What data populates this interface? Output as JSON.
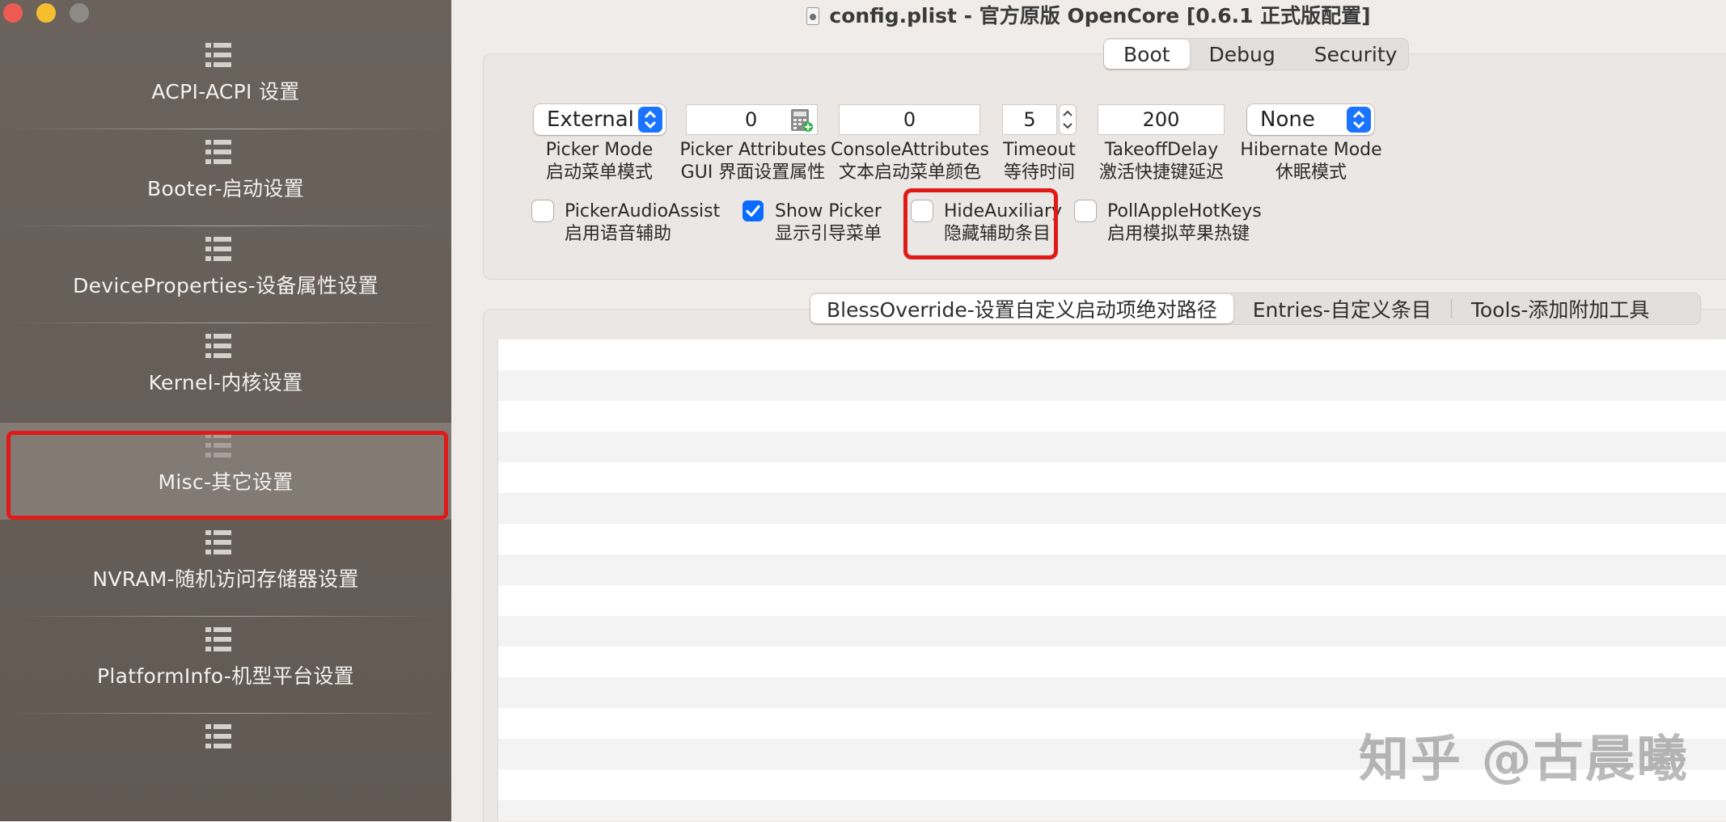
{
  "window": {
    "title": "config.plist - 官方原版 OpenCore [0.6.1 正式版配置]"
  },
  "sidebar": {
    "items": [
      {
        "label": "ACPI-ACPI 设置"
      },
      {
        "label": "Booter-启动设置"
      },
      {
        "label": "DeviceProperties-设备属性设置"
      },
      {
        "label": "Kernel-内核设置"
      },
      {
        "label": "Misc-其它设置",
        "selected": true
      },
      {
        "label": "NVRAM-随机访问存储器设置"
      },
      {
        "label": "PlatformInfo-机型平台设置"
      },
      {
        "label": ""
      }
    ]
  },
  "top_tabs": [
    "Boot",
    "Debug",
    "Security"
  ],
  "boot": {
    "picker_mode": {
      "value": "External",
      "caption1": "Picker Mode",
      "caption2": "启动菜单模式"
    },
    "picker_attributes": {
      "value": "0",
      "caption1": "Picker Attributes",
      "caption2": "GUI 界面设置属性"
    },
    "console_attributes": {
      "value": "0",
      "caption1": "ConsoleAttributes",
      "caption2": "文本启动菜单颜色"
    },
    "timeout": {
      "value": "5",
      "caption1": "Timeout",
      "caption2": "等待时间"
    },
    "takeoff_delay": {
      "value": "200",
      "caption1": "TakeoffDelay",
      "caption2": "激活快捷键延迟"
    },
    "hibernate_mode": {
      "value": "None",
      "caption1": "Hibernate Mode",
      "caption2": "休眠模式"
    },
    "checkboxes": [
      {
        "label1": "PickerAudioAssist",
        "label2": "启用语音辅助",
        "checked": false
      },
      {
        "label1": "Show Picker",
        "label2": "显示引导菜单",
        "checked": true
      },
      {
        "label1": "HideAuxiliary",
        "label2": "隐藏辅助条目",
        "checked": false
      },
      {
        "label1": "PollAppleHotKeys",
        "label2": "启用模拟苹果热键",
        "checked": false
      }
    ]
  },
  "lower_tabs": [
    "BlessOverride-设置自定义启动项绝对路径",
    "Entries-自定义条目",
    "Tools-添加附加工具"
  ],
  "watermark": "知乎 @古晨曦",
  "colors": {
    "highlight": "#e01a18",
    "accent": "#0a6bff"
  }
}
